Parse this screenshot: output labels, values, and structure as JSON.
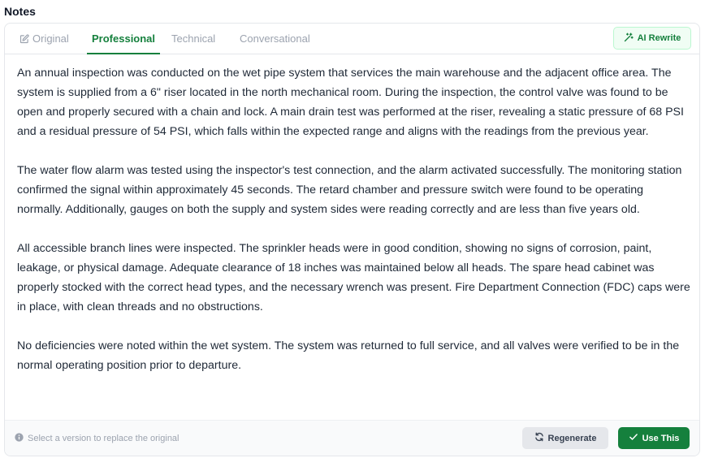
{
  "section": {
    "title": "Notes"
  },
  "tabs": [
    {
      "label": "Original",
      "icon": "edit-icon",
      "active": false
    },
    {
      "label": "Professional",
      "active": true
    },
    {
      "label": "Technical",
      "active": false
    },
    {
      "label": "Conversational",
      "active": false
    }
  ],
  "actions": {
    "ai_rewrite_label": "AI Rewrite",
    "regenerate_label": "Regenerate",
    "use_this_label": "Use This"
  },
  "content": {
    "paragraphs": [
      "An annual inspection was conducted on the wet pipe system that services the main warehouse and the adjacent office area. The system is supplied from a 6\" riser located in the north mechanical room. During the inspection, the control valve was found to be open and properly secured with a chain and lock. A main drain test was performed at the riser, revealing a static pressure of 68 PSI and a residual pressure of 54 PSI, which falls within the expected range and aligns with the readings from the previous year.",
      "The water flow alarm was tested using the inspector's test connection, and the alarm activated successfully. The monitoring station confirmed the signal within approximately 45 seconds. The retard chamber and pressure switch were found to be operating normally. Additionally, gauges on both the supply and system sides were reading correctly and are less than five years old.",
      "All accessible branch lines were inspected. The sprinkler heads were in good condition, showing no signs of corrosion, paint, leakage, or physical damage. Adequate clearance of 18 inches was maintained below all heads. The spare head cabinet was properly stocked with the correct head types, and the necessary wrench was present. Fire Department Connection (FDC) caps were in place, with clean threads and no obstructions.",
      "No deficiencies were noted within the wet system. The system was returned to full service, and all valves were verified to be in the normal operating position prior to departure."
    ]
  },
  "footer": {
    "hint": "Select a version to replace the original"
  },
  "colors": {
    "accent": "#15803d",
    "muted": "#9ca3af",
    "border": "#e5e7eb"
  }
}
